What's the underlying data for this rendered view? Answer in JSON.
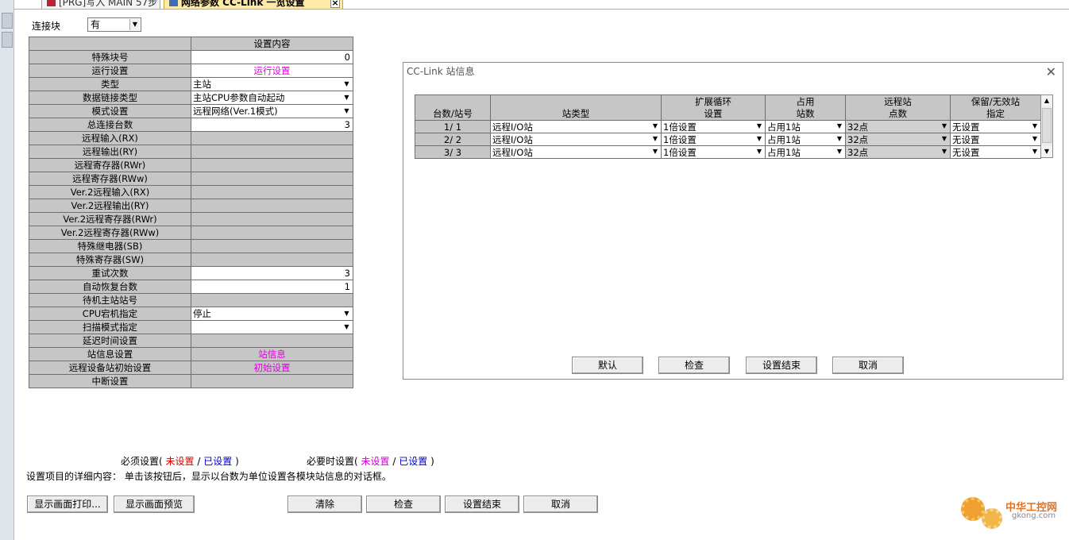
{
  "tabs": [
    {
      "label": "[PRG]写入 MAIN 57步"
    },
    {
      "label": "网络参数 CC-Link 一览设置"
    }
  ],
  "header": {
    "block_label": "连接块",
    "block_value": "有"
  },
  "params": {
    "column_header": "设置内容",
    "rows": [
      {
        "label": "特殊块号",
        "value": "0"
      },
      {
        "label": "运行设置",
        "value": "运行设置"
      },
      {
        "label": "类型",
        "value": "主站"
      },
      {
        "label": "数据链接类型",
        "value": "主站CPU参数自动起动"
      },
      {
        "label": "模式设置",
        "value": "远程网络(Ver.1模式)"
      },
      {
        "label": "总连接台数",
        "value": "3"
      },
      {
        "label": "远程输入(RX)",
        "value": ""
      },
      {
        "label": "远程输出(RY)",
        "value": ""
      },
      {
        "label": "远程寄存器(RWr)",
        "value": ""
      },
      {
        "label": "远程寄存器(RWw)",
        "value": ""
      },
      {
        "label": "Ver.2远程输入(RX)",
        "value": ""
      },
      {
        "label": "Ver.2远程输出(RY)",
        "value": ""
      },
      {
        "label": "Ver.2远程寄存器(RWr)",
        "value": ""
      },
      {
        "label": "Ver.2远程寄存器(RWw)",
        "value": ""
      },
      {
        "label": "特殊继电器(SB)",
        "value": ""
      },
      {
        "label": "特殊寄存器(SW)",
        "value": ""
      },
      {
        "label": "重试次数",
        "value": "3"
      },
      {
        "label": "自动恢复台数",
        "value": "1"
      },
      {
        "label": "待机主站站号",
        "value": ""
      },
      {
        "label": "CPU宕机指定",
        "value": "停止"
      },
      {
        "label": "扫描模式指定",
        "value": ""
      },
      {
        "label": "延迟时间设置",
        "value": ""
      },
      {
        "label": "站信息设置",
        "value": "站信息"
      },
      {
        "label": "远程设备站初始设置",
        "value": "初始设置"
      },
      {
        "label": "中断设置",
        "value": ""
      }
    ]
  },
  "dialog": {
    "title": "CC-Link 站信息",
    "columns": [
      {
        "line1": "",
        "line2": "台数/站号"
      },
      {
        "line1": "",
        "line2": "站类型"
      },
      {
        "line1": "扩展循环",
        "line2": "设置"
      },
      {
        "line1": "占用",
        "line2": "站数"
      },
      {
        "line1": "远程站",
        "line2": "点数"
      },
      {
        "line1": "保留/无效站",
        "line2": "指定"
      }
    ],
    "rows": [
      {
        "num": "1/ 1",
        "type": "远程I/O站",
        "cycle": "1倍设置",
        "occupy": "占用1站",
        "points": "32点",
        "reserve": "无设置"
      },
      {
        "num": "2/ 2",
        "type": "远程I/O站",
        "cycle": "1倍设置",
        "occupy": "占用1站",
        "points": "32点",
        "reserve": "无设置"
      },
      {
        "num": "3/ 3",
        "type": "远程I/O站",
        "cycle": "1倍设置",
        "occupy": "占用1站",
        "points": "32点",
        "reserve": "无设置"
      }
    ],
    "buttons": {
      "default": "默认",
      "check": "检查",
      "end": "设置结束",
      "cancel": "取消"
    }
  },
  "legend": {
    "required": "必须设置(",
    "optional": "必要时设置(",
    "unset": "未设置",
    "sep": "/",
    "set": "已设置",
    "close": ")"
  },
  "description": "设置项目的详细内容：   单击该按钮后，显示以台数为单位设置各模块站信息的对话框。",
  "bottom_buttons": {
    "print": "显示画面打印...",
    "preview": "显示画面预览",
    "clear": "清除",
    "check": "检查",
    "end": "设置结束",
    "cancel": "取消"
  },
  "watermark": {
    "cn": "中华工控网",
    "en": "gkong.com"
  },
  "colors": {
    "link": "#e000e0",
    "unset_required": "#d40000",
    "set": "#0000cc",
    "unset_optional": "#d400d4"
  }
}
